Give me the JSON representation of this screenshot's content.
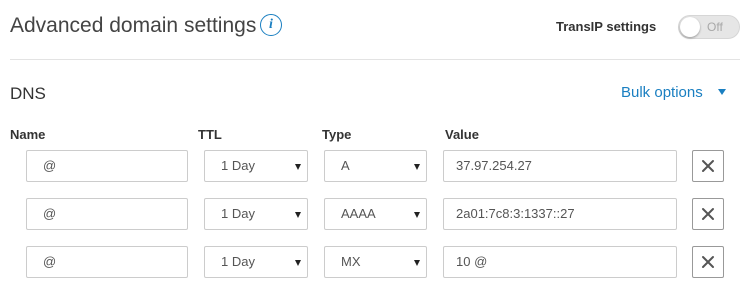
{
  "header": {
    "title": "Advanced domain settings",
    "info_icon": "info-icon",
    "settings_label": "TransIP settings",
    "toggle_state": "Off"
  },
  "dns": {
    "title": "DNS",
    "bulk_options_label": "Bulk options",
    "columns": {
      "name": "Name",
      "ttl": "TTL",
      "type": "Type",
      "value": "Value"
    },
    "records": [
      {
        "name": "@",
        "ttl": "1 Day",
        "type": "A",
        "value": "37.97.254.27"
      },
      {
        "name": "@",
        "ttl": "1 Day",
        "type": "AAAA",
        "value": "2a01:7c8:3:1337::27"
      },
      {
        "name": "@",
        "ttl": "1 Day",
        "type": "MX",
        "value": "10 @"
      }
    ],
    "delete_icon": "close-icon",
    "select_icon": "caret-down-icon"
  },
  "colors": {
    "accent": "#1a7fc1",
    "border": "#cccccc",
    "text": "#333333"
  }
}
